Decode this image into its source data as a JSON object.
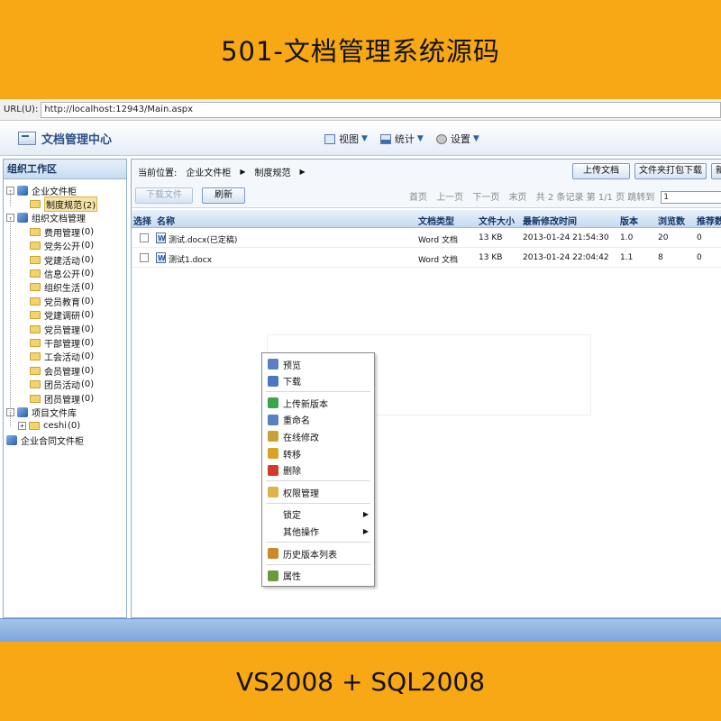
{
  "banner": {
    "title": "501-文档管理系统源码",
    "footer": "VS2008 + SQL2008"
  },
  "browser": {
    "url_label": "URL(U):",
    "url": "http://localhost:12943/Main.aspx"
  },
  "app": {
    "title": "文档管理中心",
    "menu": [
      {
        "label": "视图",
        "icon": "view-icon"
      },
      {
        "label": "统计",
        "icon": "chart-icon"
      },
      {
        "label": "设置",
        "icon": "gear-icon"
      }
    ]
  },
  "sidebar": {
    "title": "组织工作区",
    "tree": [
      {
        "label": "企业文件柜",
        "level": 0,
        "type": "cube",
        "expander": "-"
      },
      {
        "label": "制度规范",
        "count": "(2)",
        "level": 1,
        "type": "folder",
        "selected": true
      },
      {
        "label": "组织文档管理",
        "level": 0,
        "type": "cube",
        "expander": "-"
      },
      {
        "label": "费用管理",
        "count": "(0)",
        "level": 1,
        "type": "folder"
      },
      {
        "label": "党务公开",
        "count": "(0)",
        "level": 1,
        "type": "folder"
      },
      {
        "label": "党建活动",
        "count": "(0)",
        "level": 1,
        "type": "folder"
      },
      {
        "label": "信息公开",
        "count": "(0)",
        "level": 1,
        "type": "folder"
      },
      {
        "label": "组织生活",
        "count": "(0)",
        "level": 1,
        "type": "folder"
      },
      {
        "label": "党员教育",
        "count": "(0)",
        "level": 1,
        "type": "folder"
      },
      {
        "label": "党建调研",
        "count": "(0)",
        "level": 1,
        "type": "folder"
      },
      {
        "label": "党员管理",
        "count": "(0)",
        "level": 1,
        "type": "folder"
      },
      {
        "label": "干部管理",
        "count": "(0)",
        "level": 1,
        "type": "folder"
      },
      {
        "label": "工会活动",
        "count": "(0)",
        "level": 1,
        "type": "folder"
      },
      {
        "label": "会员管理",
        "count": "(0)",
        "level": 1,
        "type": "folder"
      },
      {
        "label": "团员活动",
        "count": "(0)",
        "level": 1,
        "type": "folder"
      },
      {
        "label": "团员管理",
        "count": "(0)",
        "level": 1,
        "type": "folder"
      },
      {
        "label": "项目文件库",
        "level": 0,
        "type": "cube",
        "expander": "-"
      },
      {
        "label": "ceshi",
        "count": "(0)",
        "level": 1,
        "type": "folder",
        "expander": "+"
      },
      {
        "label": "企业合同文件柜",
        "level": 0,
        "type": "cube"
      }
    ]
  },
  "main": {
    "crumb_label": "当前位置:",
    "crumbs": [
      "企业文件柜",
      "制度规范"
    ],
    "buttons": {
      "upload": "上传文档",
      "pack": "文件夹打包下载",
      "new": "新",
      "download": "下载文件",
      "refresh": "刷新"
    },
    "pager": {
      "first": "首页",
      "prev": "上一页",
      "next": "下一页",
      "last": "末页",
      "info": "共 2 条记录 第 1/1 页 跳转到",
      "jump_value": "1"
    },
    "columns": [
      "选择",
      "名称",
      "文档类型",
      "文件大小",
      "最新修改时间",
      "版本",
      "浏览数",
      "推荐数"
    ],
    "rows": [
      {
        "name": "测试.docx(已定稿)",
        "type": "Word 文档",
        "size": "13 KB",
        "modified": "2013-01-24 21:54:30",
        "version": "1.0",
        "views": "20",
        "recommend": "0"
      },
      {
        "name": "测试1.docx",
        "type": "Word 文档",
        "size": "13 KB",
        "modified": "2013-01-24 22:04:42",
        "version": "1.1",
        "views": "8",
        "recommend": "0"
      }
    ]
  },
  "context_menu": {
    "items": [
      {
        "label": "预览",
        "icon": "preview-icon",
        "color": "#5a7fc4"
      },
      {
        "label": "下载",
        "icon": "download-icon",
        "color": "#4a78c0"
      },
      {
        "sep": true
      },
      {
        "label": "上传新版本",
        "icon": "upload-icon",
        "color": "#3aa54a"
      },
      {
        "label": "重命名",
        "icon": "rename-icon",
        "color": "#5a7fc4"
      },
      {
        "label": "在线修改",
        "icon": "edit-online-icon",
        "color": "#c9a233"
      },
      {
        "label": "转移",
        "icon": "move-icon",
        "color": "#d9a323"
      },
      {
        "label": "删除",
        "icon": "delete-icon",
        "color": "#d23a2a"
      },
      {
        "sep": true
      },
      {
        "label": "权限管理",
        "icon": "permission-icon",
        "color": "#e0b24a"
      },
      {
        "sep": true
      },
      {
        "label": "锁定",
        "submenu": true
      },
      {
        "label": "其他操作",
        "submenu": true
      },
      {
        "sep": true
      },
      {
        "label": "历史版本列表",
        "icon": "history-icon",
        "color": "#c98a2a"
      },
      {
        "sep": true
      },
      {
        "label": "属性",
        "icon": "properties-icon",
        "color": "#6a9a3a"
      }
    ]
  }
}
